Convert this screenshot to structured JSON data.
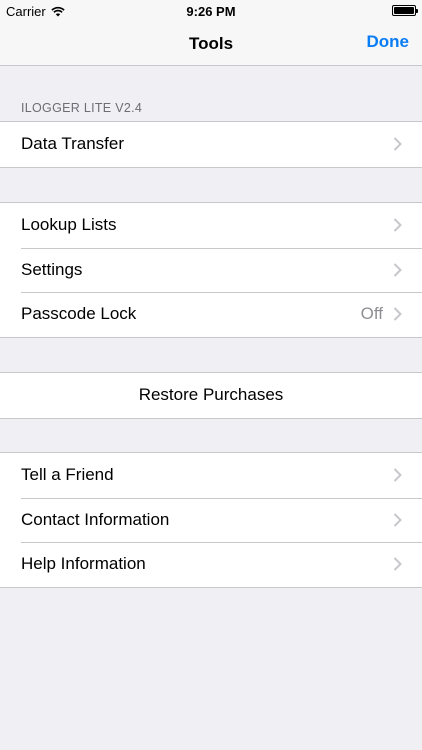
{
  "status_bar": {
    "carrier": "Carrier",
    "time": "9:26 PM"
  },
  "nav": {
    "title": "Tools",
    "done_label": "Done"
  },
  "sections": {
    "app_header": "ILOGGER LITE V2.4",
    "group1": [
      {
        "label": "Data Transfer"
      }
    ],
    "group2": [
      {
        "label": "Lookup Lists"
      },
      {
        "label": "Settings"
      },
      {
        "label": "Passcode Lock",
        "value": "Off"
      }
    ],
    "group3": [
      {
        "label": "Restore Purchases"
      }
    ],
    "group4": [
      {
        "label": "Tell a Friend"
      },
      {
        "label": "Contact Information"
      },
      {
        "label": "Help Information"
      }
    ]
  },
  "colors": {
    "accent": "#0a7cf5",
    "background": "#efeff4",
    "separator": "#c8c7cc",
    "secondary_text": "#8e8e93"
  },
  "icons": {
    "disclosure": "chevron-right-icon",
    "wifi": "wifi-icon",
    "battery": "battery-icon"
  }
}
